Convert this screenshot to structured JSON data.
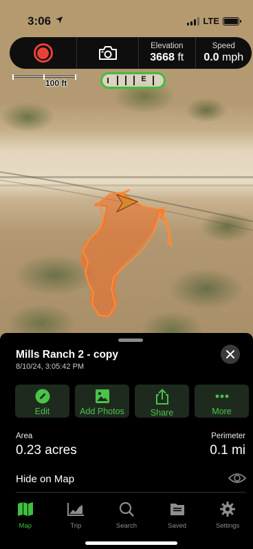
{
  "status_bar": {
    "time": "3:06",
    "network": "LTE"
  },
  "toolbar": {
    "elevation_label": "Elevation",
    "elevation_value": "3668",
    "elevation_unit": "ft",
    "speed_label": "Speed",
    "speed_value": "0.0",
    "speed_unit": "mph"
  },
  "map": {
    "scale_label": "100 ft",
    "compass_letter": "E",
    "track_color": "#f2782a"
  },
  "track": {
    "title": "Mills Ranch 2 - copy",
    "date": "8/10/24, 3:05:42 PM"
  },
  "actions": [
    {
      "label": "Edit",
      "icon": "edit-pencil-icon"
    },
    {
      "label": "Add Photos",
      "icon": "photo-icon"
    },
    {
      "label": "Share",
      "icon": "share-icon"
    },
    {
      "label": "More",
      "icon": "more-dots-icon"
    }
  ],
  "stats": {
    "area_label": "Area",
    "area_value": "0.23 acres",
    "perimeter_label": "Perimeter",
    "perimeter_value": "0.1 mi"
  },
  "hide_on_map_label": "Hide on Map",
  "tabs": [
    {
      "label": "Map",
      "icon": "map-icon",
      "active": true
    },
    {
      "label": "Trip",
      "icon": "trip-chart-icon",
      "active": false
    },
    {
      "label": "Search",
      "icon": "search-icon",
      "active": false
    },
    {
      "label": "Saved",
      "icon": "saved-folder-icon",
      "active": false
    },
    {
      "label": "Settings",
      "icon": "gear-icon",
      "active": false
    }
  ],
  "colors": {
    "accent_green": "#3fbf3f",
    "record_red": "#e8413a",
    "track_orange": "#f2782a"
  }
}
